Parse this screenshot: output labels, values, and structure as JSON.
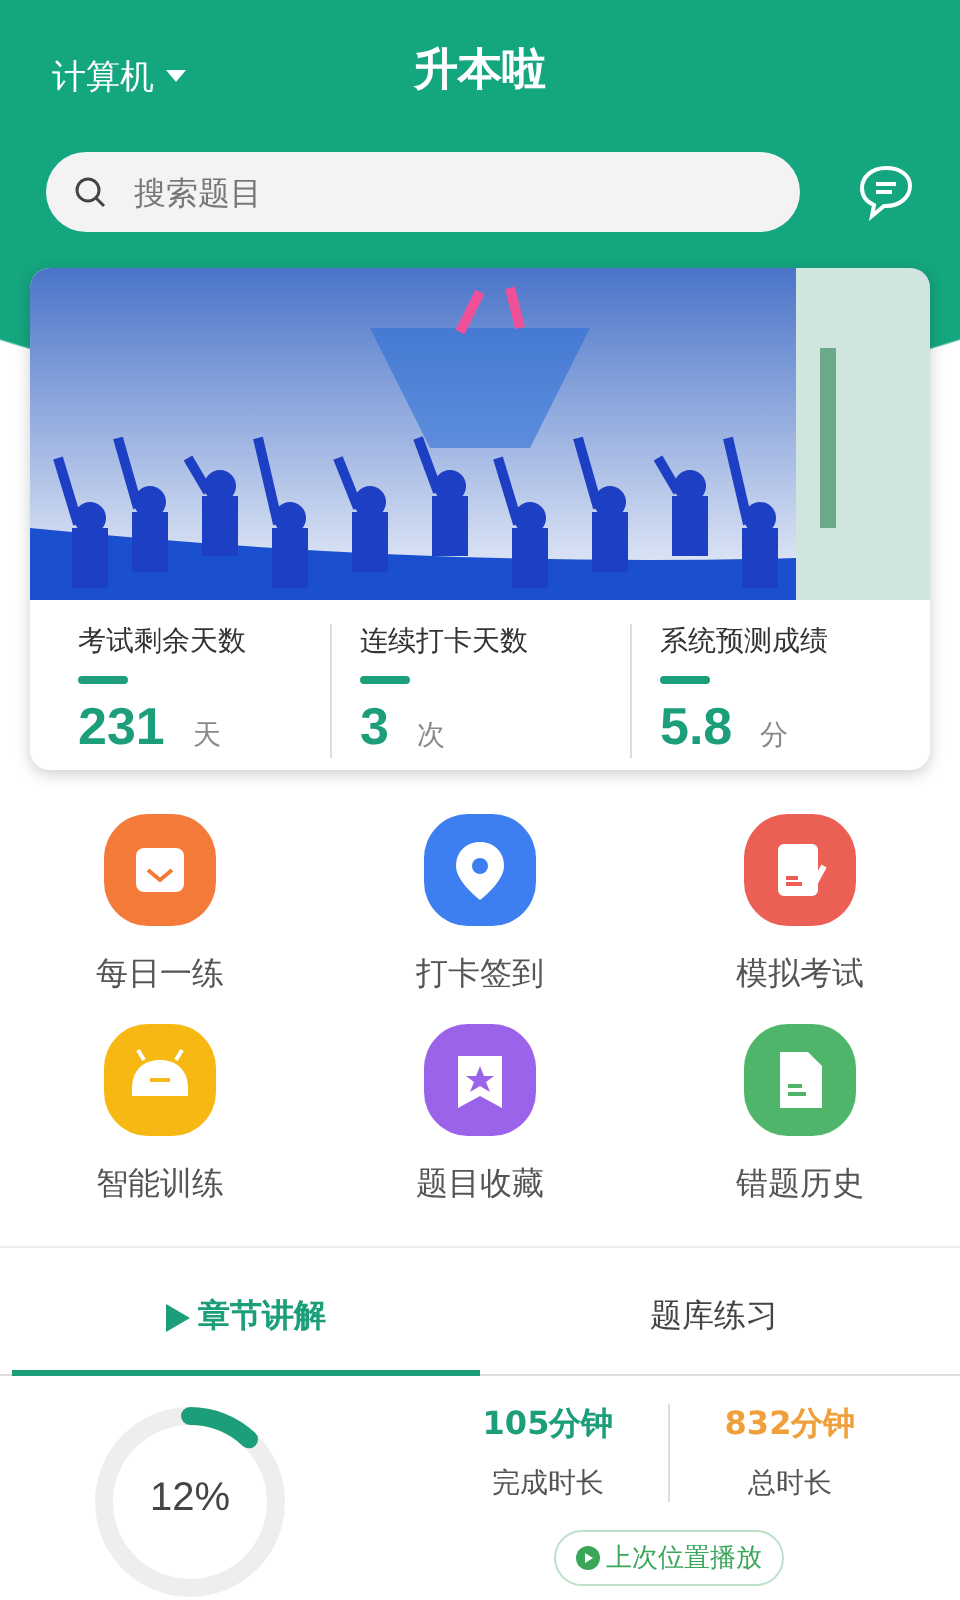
{
  "header": {
    "category": "计算机",
    "title": "升本啦"
  },
  "search": {
    "placeholder": "搜索题目"
  },
  "stats": [
    {
      "label": "考试剩余天数",
      "value": "231",
      "unit": "天"
    },
    {
      "label": "连续打卡天数",
      "value": "3",
      "unit": "次"
    },
    {
      "label": "系统预测成绩",
      "value": "5.8",
      "unit": "分"
    }
  ],
  "features": [
    {
      "label": "每日一练",
      "kind": "calendar",
      "color": "#f47a3a"
    },
    {
      "label": "打卡签到",
      "kind": "location",
      "color": "#3d7ef0"
    },
    {
      "label": "模拟考试",
      "kind": "exam",
      "color": "#ec5f55"
    },
    {
      "label": "智能训练",
      "kind": "robot",
      "color": "#f8b814"
    },
    {
      "label": "题目收藏",
      "kind": "bookmark",
      "color": "#9b62ea"
    },
    {
      "label": "错题历史",
      "kind": "document",
      "color": "#4fb56a"
    }
  ],
  "tabs": [
    {
      "label": "章节讲解",
      "selected": true
    },
    {
      "label": "题库练习",
      "selected": false
    }
  ],
  "progress": {
    "level": 0.12,
    "reading": "12%"
  },
  "durations": [
    {
      "value": "105分钟",
      "label": "完成时长",
      "color": "#1c9e7a"
    },
    {
      "value": "832分钟",
      "label": "总时长",
      "color": "#f0a03a"
    }
  ],
  "resume_button": "上次位置播放"
}
